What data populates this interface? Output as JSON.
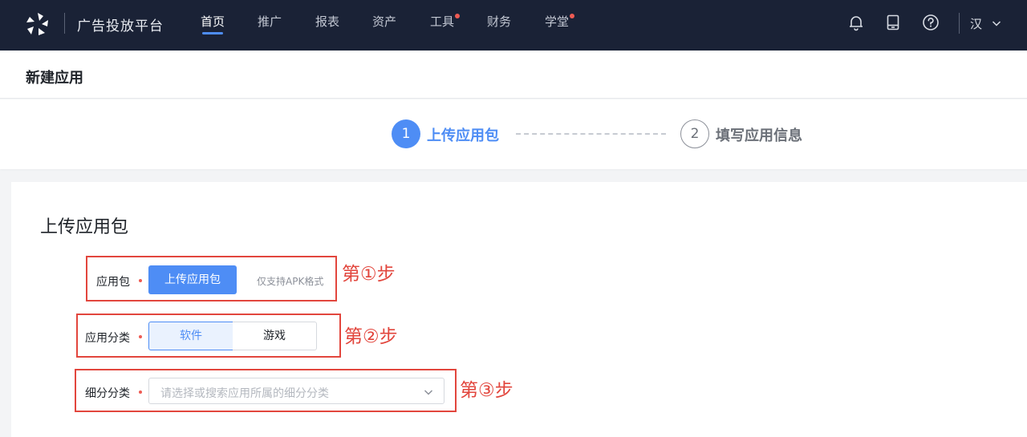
{
  "app": {
    "brand": "广告投放平台",
    "logo_icon": "pinwheel-logo-icon",
    "accent_color": "#4e8df5",
    "nav_bg_color": "#1a2236"
  },
  "nav": {
    "items": [
      {
        "label": "首页",
        "active": true,
        "badge": false
      },
      {
        "label": "推广",
        "active": false,
        "badge": false
      },
      {
        "label": "报表",
        "active": false,
        "badge": false
      },
      {
        "label": "资产",
        "active": false,
        "badge": false
      },
      {
        "label": "工具",
        "active": false,
        "badge": true
      },
      {
        "label": "财务",
        "active": false,
        "badge": false
      },
      {
        "label": "学堂",
        "active": false,
        "badge": true
      }
    ],
    "badge_color": "#ee5b53"
  },
  "toolbar": {
    "icons": [
      "bell-icon",
      "tablet-icon",
      "help-circle-icon"
    ],
    "language": "汉"
  },
  "page": {
    "title": "新建应用"
  },
  "steps": [
    {
      "number": "1",
      "label": "上传应用包",
      "state": "active"
    },
    {
      "number": "2",
      "label": "填写应用信息",
      "state": "pending"
    }
  ],
  "form": {
    "section_title": "上传应用包",
    "package": {
      "label": "应用包",
      "required": true,
      "button_label": "上传应用包",
      "hint": "仅支持APK格式"
    },
    "category": {
      "label": "应用分类",
      "required": true,
      "options": [
        "软件",
        "游戏"
      ],
      "selected": "软件"
    },
    "subcategory": {
      "label": "细分分类",
      "required": true,
      "placeholder": "请选择或搜索应用所属的细分分类"
    }
  },
  "annotations": {
    "step1": "第①步",
    "step2": "第②步",
    "step3": "第③步",
    "color": "#e2463d"
  }
}
